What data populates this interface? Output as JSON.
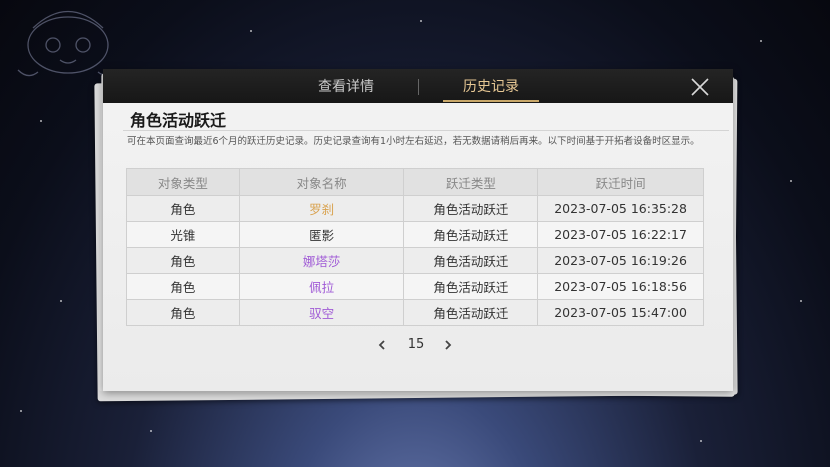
{
  "tabs": [
    {
      "label": "查看详情",
      "active": false
    },
    {
      "label": "历史记录",
      "active": true
    }
  ],
  "close_icon": "close-icon",
  "section_title": "角色活动跃迁",
  "description": "可在本页面查询最近6个月的跃迁历史记录。历史记录查询有1小时左右延迟，若无数据请稍后再来。以下时间基于开拓者设备时区显示。",
  "table": {
    "headers": [
      "对象类型",
      "对象名称",
      "跃迁类型",
      "跃迁时间"
    ],
    "rows": [
      {
        "type": "角色",
        "name": "罗刹",
        "warp_type": "角色活动跃迁",
        "time": "2023-07-05 16:35:28",
        "name_color": "#d9a24e"
      },
      {
        "type": "光锥",
        "name": "匿影",
        "warp_type": "角色活动跃迁",
        "time": "2023-07-05 16:22:17",
        "name_color": "#333333"
      },
      {
        "type": "角色",
        "name": "娜塔莎",
        "warp_type": "角色活动跃迁",
        "time": "2023-07-05 16:19:26",
        "name_color": "#a05bd6"
      },
      {
        "type": "角色",
        "name": "佩拉",
        "warp_type": "角色活动跃迁",
        "time": "2023-07-05 16:18:56",
        "name_color": "#a05bd6"
      },
      {
        "type": "角色",
        "name": "驭空",
        "warp_type": "角色活动跃迁",
        "time": "2023-07-05 15:47:00",
        "name_color": "#a05bd6"
      }
    ]
  },
  "pager": {
    "page": "15",
    "prev_icon": "chevron-left-icon",
    "next_icon": "chevron-right-icon"
  },
  "colors": {
    "accent_gold": "#e7c894",
    "rarity_5": "#d9a24e",
    "rarity_4": "#a05bd6"
  }
}
